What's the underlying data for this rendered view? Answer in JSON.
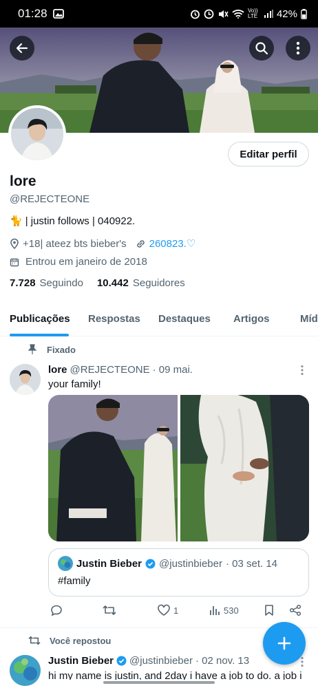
{
  "status_bar": {
    "time": "01:28",
    "network": "Vo)) LTE",
    "battery": "42%"
  },
  "profile": {
    "name": "lore",
    "handle": "@REJECTEONE",
    "bio_emoji": "🐈",
    "bio": "| justin follows | 040922.",
    "location": "+18| ateez bts bieber's",
    "link": "260823.♡",
    "joined": "Entrou em janeiro de 2018",
    "following_count": "7.728",
    "following_label": "Seguindo",
    "followers_count": "10.442",
    "followers_label": "Seguidores",
    "edit_label": "Editar perfil"
  },
  "tabs": [
    {
      "label": "Publicações"
    },
    {
      "label": "Respostas"
    },
    {
      "label": "Destaques"
    },
    {
      "label": "Artigos"
    },
    {
      "label": "Mídia"
    }
  ],
  "pinned_tweet": {
    "pinned_label": "Fixado",
    "author": "lore",
    "handle": "@REJECTEONE",
    "date": "· 09 mai.",
    "text": "your family!",
    "quote": {
      "author": "Justin Bieber",
      "handle": "@justinbieber",
      "date": "· 03 set. 14",
      "text": "#family"
    },
    "likes": "1",
    "views": "530"
  },
  "second_tweet": {
    "repost_label": "Você repostou",
    "author": "Justin Bieber",
    "handle": "@justinbieber",
    "date": "· 02 nov. 13",
    "text": "hi my name is justin, and 2day i have a job to do. a job i"
  },
  "colors": {
    "accent": "#1d9bf0",
    "text": "#0f1419",
    "muted": "#536471"
  },
  "icons": [
    "back-arrow-icon",
    "search-icon",
    "more-vertical-icon",
    "location-icon",
    "link-icon",
    "calendar-icon",
    "pin-icon",
    "reply-icon",
    "retweet-icon",
    "heart-icon",
    "views-icon",
    "bookmark-icon",
    "share-icon",
    "verified-icon",
    "plus-icon"
  ]
}
